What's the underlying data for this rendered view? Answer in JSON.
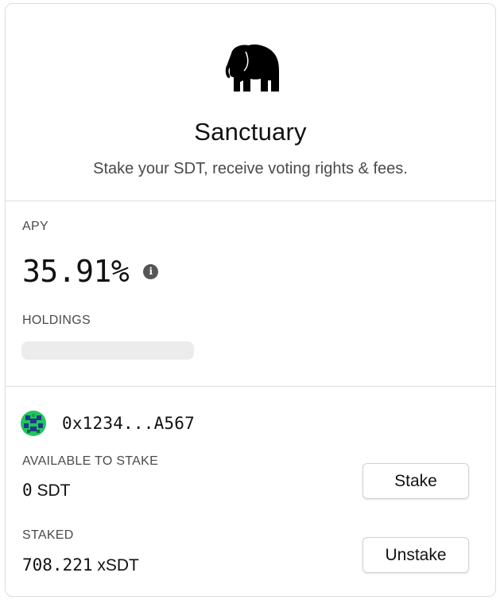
{
  "header": {
    "logo_icon": "elephant-icon",
    "title": "Sanctuary",
    "subtitle": "Stake your SDT, receive voting rights & fees."
  },
  "stats": {
    "apy_label": "APY",
    "apy_value": "35.91%",
    "info_icon": "info-icon",
    "holdings_label": "HOLDINGS"
  },
  "account": {
    "avatar_icon": "identicon-avatar",
    "address": "0x1234...A567",
    "available_label": "AVAILABLE TO STAKE",
    "available_amount": "0",
    "available_unit": "SDT",
    "staked_label": "STAKED",
    "staked_amount": "708.221",
    "staked_unit": "xSDT"
  },
  "actions": {
    "stake_label": "Stake",
    "unstake_label": "Unstake"
  },
  "colors": {
    "text_primary": "#111111",
    "text_secondary": "#4b4b4b",
    "border": "#dcdcdc",
    "skeleton": "#ececec",
    "avatar_green": "#22c55e",
    "avatar_blue": "#1e3a8a"
  }
}
